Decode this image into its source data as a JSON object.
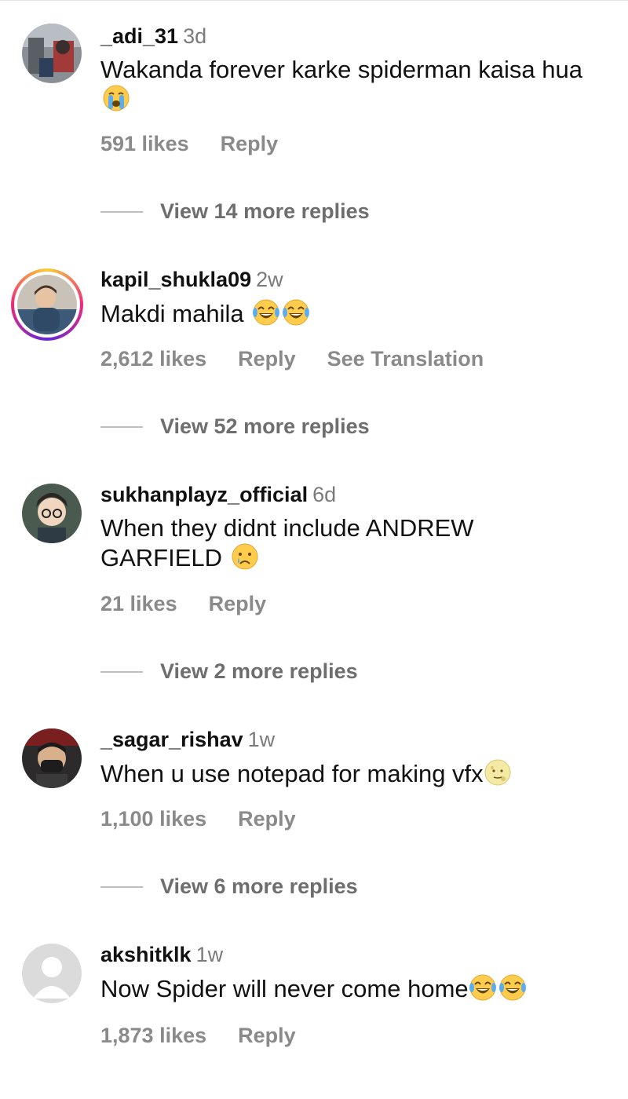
{
  "comments": [
    {
      "username": "_adi_31",
      "time": "3d",
      "text": "Wakanda forever karke spiderman kaisa hua",
      "emojis": [
        "loudly-crying-face"
      ],
      "likes": "591 likes",
      "reply": "Reply",
      "translate": "",
      "view_replies": "View 14 more replies"
    },
    {
      "username": "kapil_shukla09",
      "time": "2w",
      "text": "Makdi mahila",
      "emojis": [
        "tears-of-joy-face",
        "tears-of-joy-face"
      ],
      "likes": "2,612 likes",
      "reply": "Reply",
      "translate": "See Translation",
      "view_replies": "View 52 more replies"
    },
    {
      "username": "sukhanplayz_official",
      "time": "6d",
      "text": "When they didnt include ANDREW GARFIELD",
      "emojis": [
        "crying-face"
      ],
      "likes": "21 likes",
      "reply": "Reply",
      "translate": "",
      "view_replies": "View 2 more replies"
    },
    {
      "username": "_sagar_rishav",
      "time": "1w",
      "text": "When u use notepad for making vfx",
      "emojis": [
        "moon-face"
      ],
      "likes": "1,100 likes",
      "reply": "Reply",
      "translate": "",
      "view_replies": "View 6 more replies"
    },
    {
      "username": "akshitklk",
      "time": "1w",
      "text": "Now Spider will never come home",
      "emojis": [
        "tears-of-joy-face",
        "tears-of-joy-face"
      ],
      "likes": "1,873 likes",
      "reply": "Reply",
      "translate": "",
      "view_replies": ""
    }
  ],
  "colors": {
    "username": "#111111",
    "secondary": "#8a8a8a",
    "story_ring_start": "#f9ce34",
    "story_ring_end": "#ee2a7b"
  }
}
